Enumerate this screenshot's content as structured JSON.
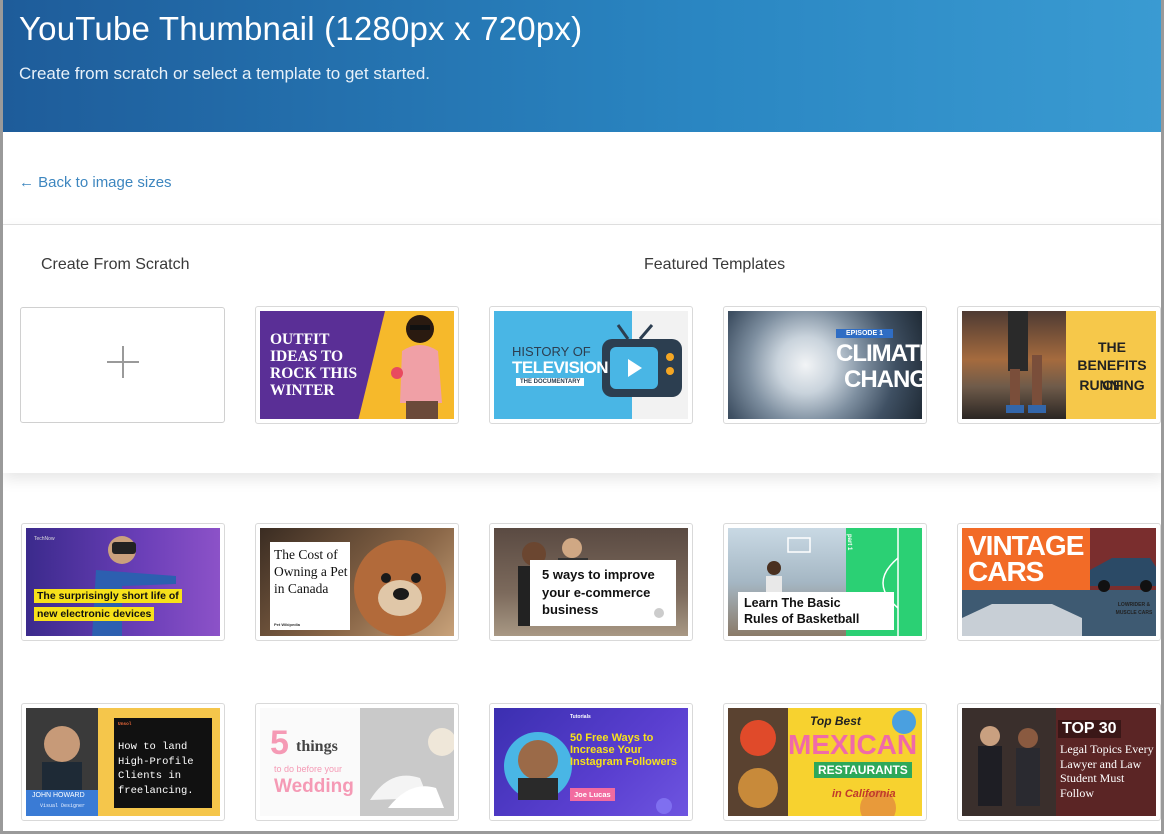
{
  "header": {
    "title": "YouTube Thumbnail (1280px x 720px)",
    "subtitle": "Create from scratch or select a template to get started."
  },
  "nav": {
    "back_label": "← Back to image sizes"
  },
  "sections": {
    "scratch_title": "Create From Scratch",
    "featured_title": "Featured Templates"
  },
  "templates": {
    "outfit": {
      "text": "OUTFIT IDEAS TO ROCK THIS WINTER"
    },
    "television": {
      "line1": "HISTORY OF",
      "line2": "TELEVISION",
      "line3": "THE DOCUMENTARY"
    },
    "climate": {
      "badge": "EPISODE 1",
      "line1": "CLIMATE",
      "line2": "CHANGE"
    },
    "running": {
      "line1": "THE",
      "line2": "BENEFITS OF",
      "line3": "RUNNING"
    },
    "devices": {
      "brand": "TechNow",
      "line1": "The surprisingly short life of",
      "line2": "new electronic devices"
    },
    "pet": {
      "text": "The Cost of Owning a Pet in Canada",
      "footer": "Pet Wikipedia"
    },
    "ecommerce": {
      "text": "5 ways to improve your e-commerce business"
    },
    "basketball": {
      "line1": "Learn The Basic",
      "line2": "Rules of Basketball",
      "side": "part 1"
    },
    "cars": {
      "line1": "VINTAGE",
      "line2": "CARS",
      "sub1": "LOWRIDER &",
      "sub2": "MUSCLE CARS"
    },
    "freelance": {
      "tag": "Unsol",
      "text": "How to land High-Profile Clients in freelancing.",
      "name": "JOHN HOWARD",
      "role": "Visual Designer"
    },
    "wedding": {
      "num": "5",
      "word": "things",
      "sub": "to do before your",
      "title": "Wedding"
    },
    "instagram": {
      "tag": "Tutorials",
      "text": "50 Free Ways to Increase Your Instagram Followers",
      "name": "Joe Lucas"
    },
    "mexican": {
      "top": "Top Best",
      "line1": "MEXICAN",
      "line2": "RESTAURANTS",
      "line3": "in California"
    },
    "legal": {
      "top": "TOP 30",
      "text": "Legal Topics Every Lawyer and Law Student Must Follow"
    }
  },
  "colors": {
    "header_start": "#1e5c9a",
    "header_end": "#3a9bd2",
    "link": "#3d86bf"
  }
}
